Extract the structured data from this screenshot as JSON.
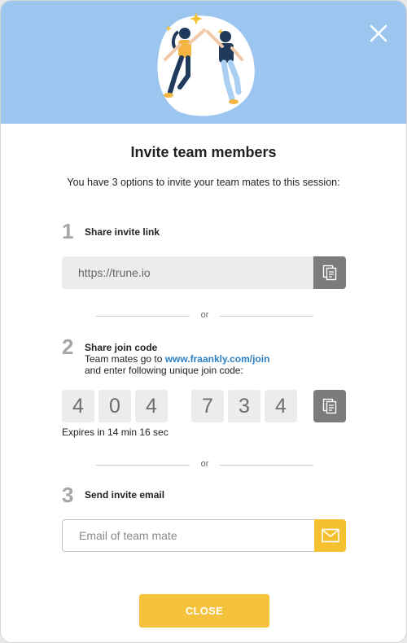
{
  "modal": {
    "title": "Invite team members",
    "subtitle": "You have 3 options to invite your team mates to this session:"
  },
  "steps": [
    {
      "number": "1",
      "label": "Share invite link",
      "link_value": "https://trune.io"
    },
    {
      "number": "2",
      "label": "Share join code",
      "text_prefix": "Team mates go to ",
      "url": "www.fraankly.com/join",
      "text_line2": "and enter following unique join code:",
      "code_digits": [
        "4",
        "0",
        "4",
        "7",
        "3",
        "4"
      ],
      "expires": "Expires in 14 min 16 sec"
    },
    {
      "number": "3",
      "label": "Send invite email",
      "email_placeholder": "Email of team mate"
    }
  ],
  "separator_text": "or",
  "close_label": "CLOSE",
  "icons": {
    "close": "close-icon",
    "copy": "copy-icon",
    "mail": "mail-icon"
  },
  "colors": {
    "hero_bg": "#9cc6ef",
    "accent_yellow": "#f5c33b",
    "link_blue": "#2d7fc1",
    "copy_button": "#7b7b7b"
  }
}
